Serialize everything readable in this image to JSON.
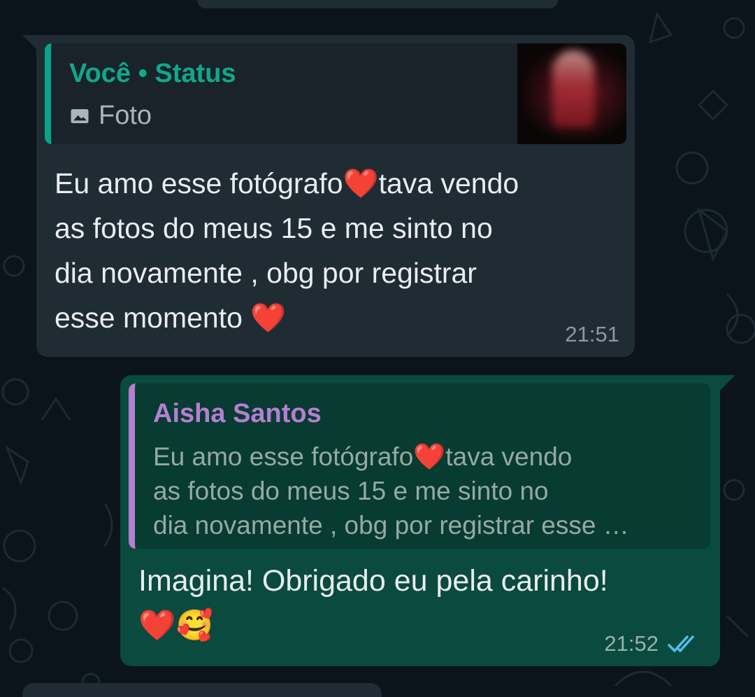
{
  "incoming": {
    "quote_author": "Você • Status",
    "quote_media_icon": "image-icon",
    "quote_media_label": "Foto",
    "text": "Eu amo esse fotógrafo❤️tava vendo\nas fotos do meus 15 e me sinto no\ndia novamente , obg por registrar\nesse momento ❤️",
    "time": "21:51"
  },
  "outgoing": {
    "quote_author": "Aisha Santos",
    "quote_text": "Eu amo esse fotógrafo❤️tava vendo\nas fotos do meus 15 e me sinto no\ndia novamente , obg por registrar esse …",
    "text": "Imagina! Obrigado eu pela carinho!\n❤️🥰",
    "time": "21:52",
    "status_icon": "double-check-read-icon"
  },
  "colors": {
    "chat_background": "#0b141a",
    "incoming_bubble": "#202c33",
    "outgoing_bubble": "#0b4a3e",
    "status_quote_accent": "#06a58a",
    "reply_quote_accent": "#b57fd1",
    "read_ticks": "#53bdeb"
  }
}
